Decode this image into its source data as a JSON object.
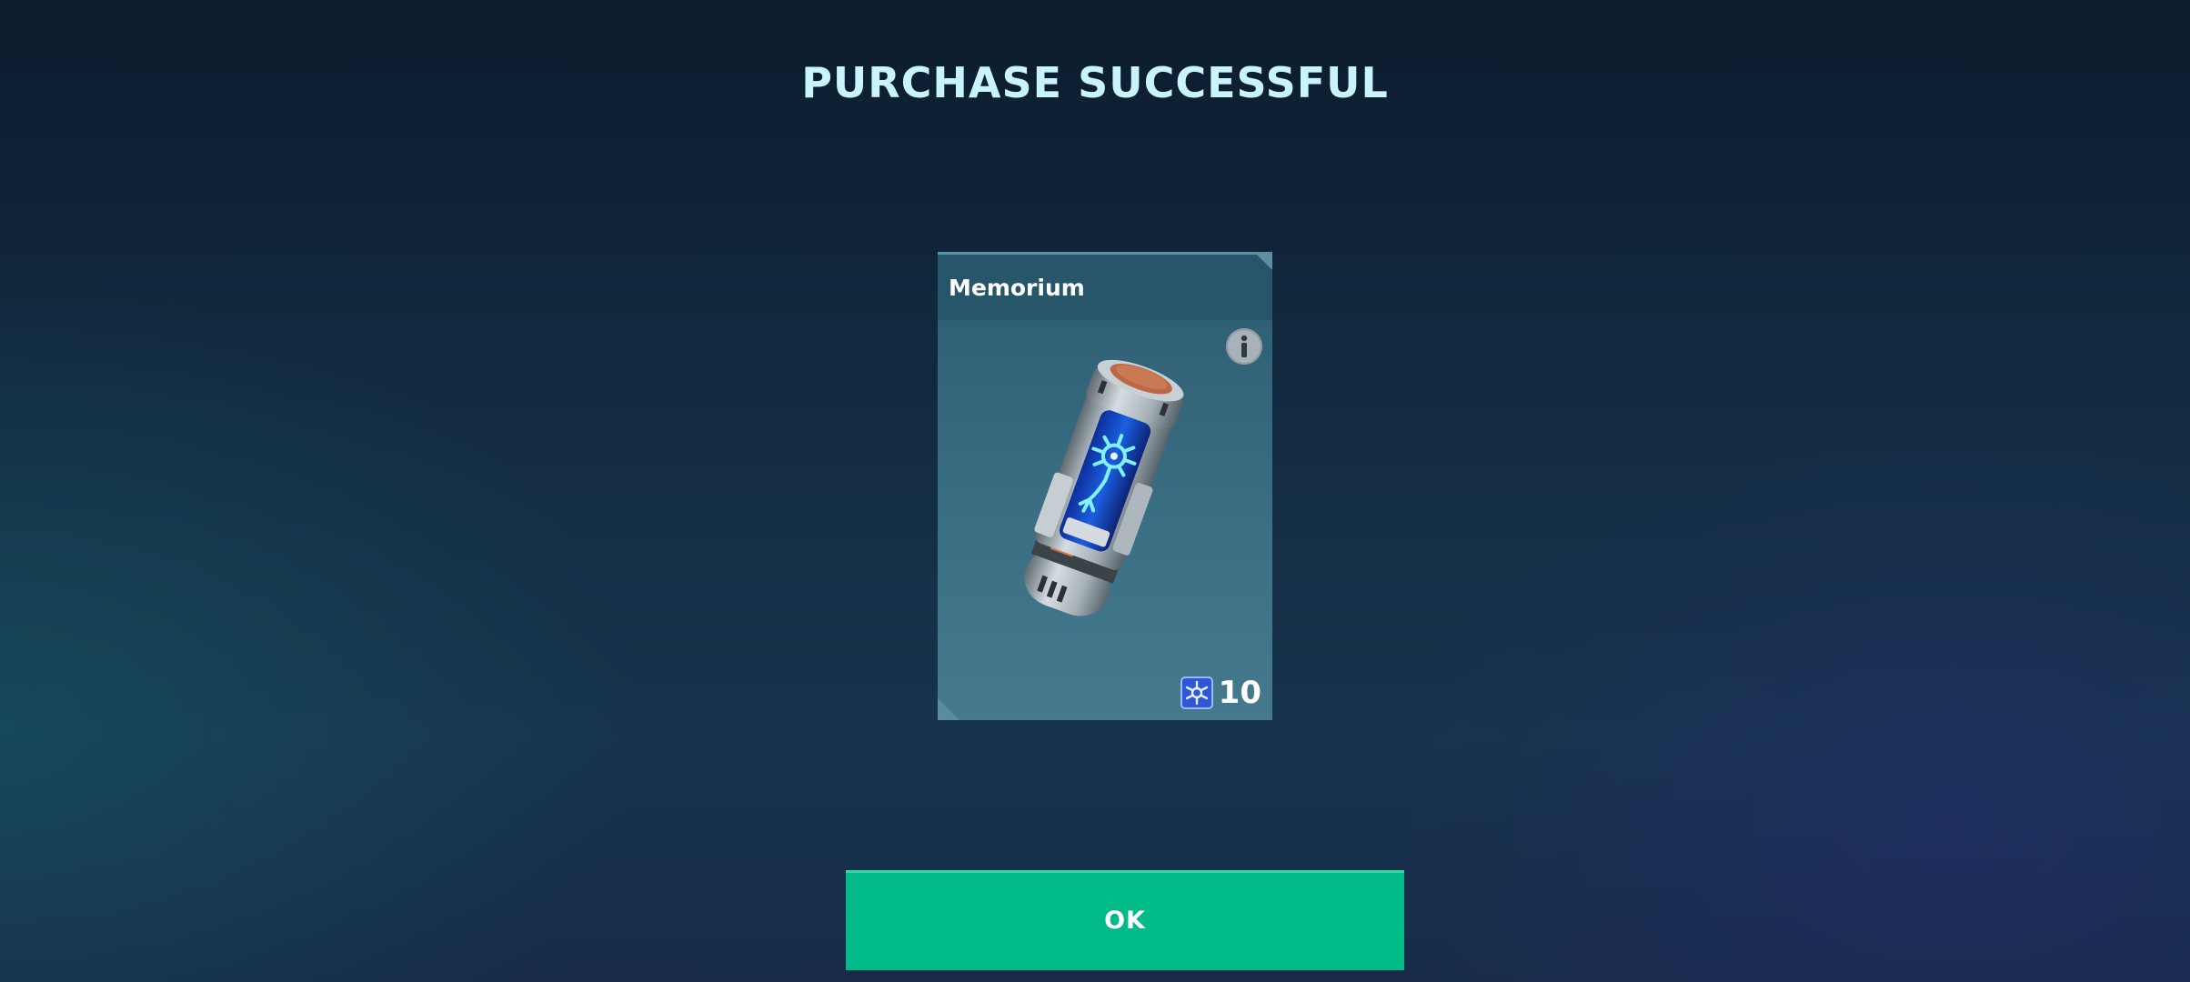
{
  "dialog": {
    "title": "PURCHASE SUCCESSFUL",
    "ok_label": "OK"
  },
  "item": {
    "name": "Memorium",
    "image_icon": "memorium-canister-icon",
    "info_icon": "info-icon",
    "price": {
      "amount": "10",
      "currency_icon": "blue-currency-icon"
    }
  },
  "colors": {
    "title": "#c9f4fb",
    "card_header": "#27566a",
    "ok_button": "#00bb87"
  }
}
